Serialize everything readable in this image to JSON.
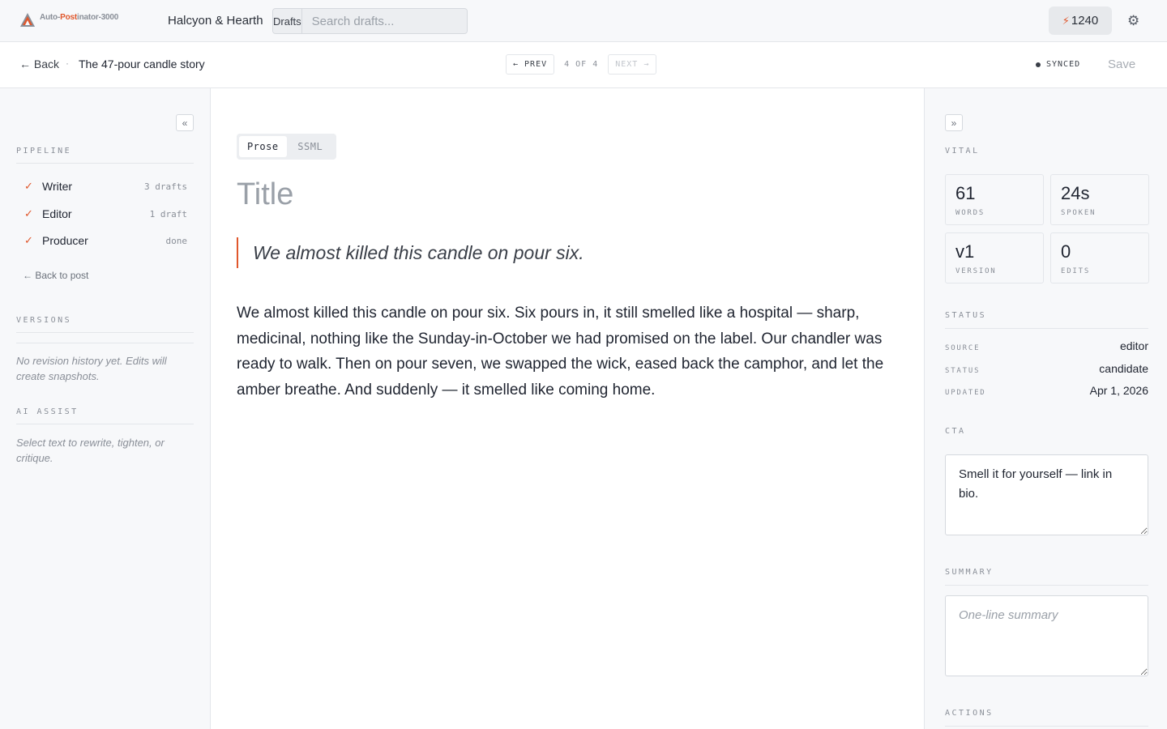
{
  "app": {
    "logo_text_a": "Auto-",
    "logo_text_b": "Post",
    "logo_text_c": "inator-3000",
    "logo_icon": "triangle-logo-icon",
    "brand_name": "Halcyon & Hearth"
  },
  "header": {
    "drafts_label": "Drafts",
    "search_placeholder": "Search drafts...",
    "credits": "1240",
    "credits_icon": "bolt-icon",
    "settings_icon": "gear-icon"
  },
  "subbar": {
    "back_label": "← Back",
    "separator": "·",
    "post_title": "The 47-pour candle story",
    "prev_label": "← PREV",
    "page_count": "4 OF 4",
    "next_label": "NEXT →",
    "sync_status": "SYNCED",
    "save_label": "Save"
  },
  "left": {
    "collapse_icon": "«",
    "pipeline_label": "PIPELINE",
    "pipeline": [
      {
        "name": "Writer",
        "meta": "3 drafts",
        "check": "✓"
      },
      {
        "name": "Editor",
        "meta": "1 draft",
        "check": "✓"
      },
      {
        "name": "Producer",
        "meta": "done",
        "check": "✓"
      }
    ],
    "back_to_post": "← Back to post",
    "versions_label": "VERSIONS",
    "versions_hint": "No revision history yet. Edits will create snapshots.",
    "ai_label": "AI ASSIST",
    "ai_hint": "Select text to rewrite, tighten, or critique."
  },
  "editor": {
    "modes": [
      "Prose",
      "SSML"
    ],
    "active_mode": "Prose",
    "title_placeholder": "Title",
    "hook": "We almost killed this candle on pour six.",
    "body": "We almost killed this candle on pour six. Six pours in, it still smelled like a hospital — sharp, medicinal, nothing like the Sunday-in-October we had promised on the label. Our chandler was ready to walk. Then on pour seven, we swapped the wick, eased back the camphor, and let the amber breathe. And suddenly — it smelled like coming home."
  },
  "right": {
    "expand_icon": "»",
    "vital_label": "VITAL",
    "stats": [
      {
        "value": "61",
        "label": "WORDS"
      },
      {
        "value": "24s",
        "label": "SPOKEN"
      },
      {
        "value": "v1",
        "label": "VERSION"
      },
      {
        "value": "0",
        "label": "EDITS"
      }
    ],
    "status_label": "STATUS",
    "status_rows": [
      {
        "key": "SOURCE",
        "value": "editor"
      },
      {
        "key": "STATUS",
        "value": "candidate"
      },
      {
        "key": "UPDATED",
        "value": "Apr 1, 2026"
      }
    ],
    "cta_label": "CTA",
    "cta_value": "Smell it for yourself — link in bio.",
    "summary_label": "SUMMARY",
    "summary_placeholder": "One-line summary",
    "actions_label": "ACTIONS"
  },
  "colors": {
    "accent": "#e0572c",
    "panel_bg": "#f7f8fa",
    "border": "#e3e6ea"
  }
}
